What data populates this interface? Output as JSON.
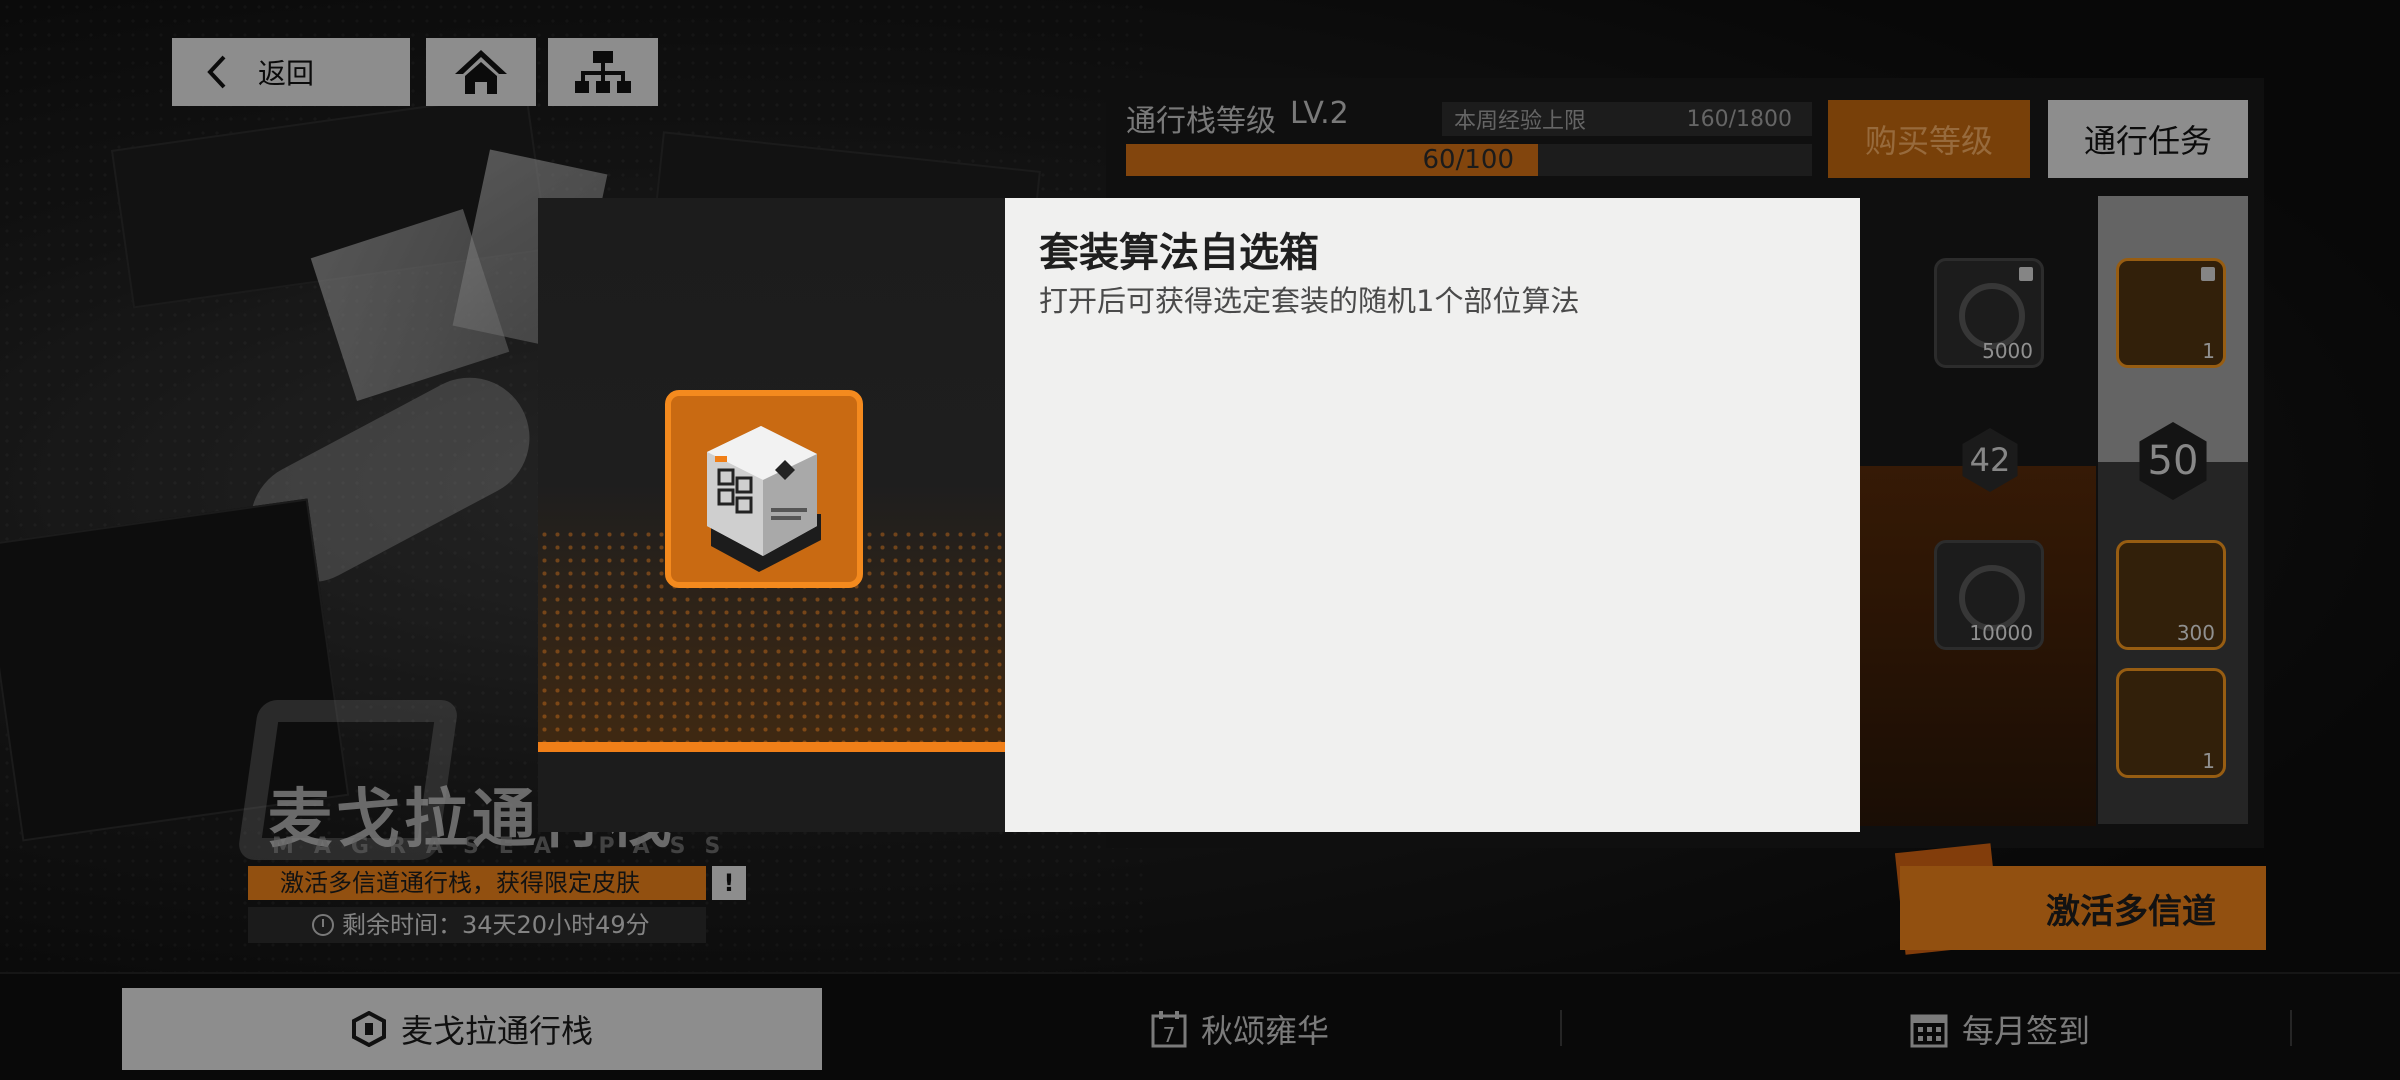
{
  "nav": {
    "back_label": "返回",
    "back_icon": "chevron-left-icon",
    "home_icon": "home-icon",
    "map_icon": "hierarchy-icon"
  },
  "pass": {
    "title": "麦戈拉通行栈",
    "subtitle": "MAGRASEA PASS",
    "promo_text": "激活多信道通行栈，获得限定皮肤",
    "promo_alert": "!",
    "remaining_time": "剩余时间：34天20小时49分",
    "level_label": "通行栈等级",
    "level_value": "LV.2",
    "weekly_cap_label": "本周经验上限",
    "weekly_cap_value": "160/1800",
    "xp_text": "60/100",
    "xp_fraction": 0.6,
    "buy_level_label": "购买等级",
    "tasks_label": "通行任务",
    "activate_label": "激活多信道",
    "rewards": {
      "slot_a_qty": "5000",
      "slot_b_qty": "10000",
      "slot_c_qty": "1",
      "slot_d_qty": "300",
      "slot_e_qty": "1",
      "level_42": "42",
      "level_50": "50"
    }
  },
  "tabs": [
    {
      "label": "麦戈拉通行栈",
      "icon": "pass-logo-icon"
    },
    {
      "label": "秋颂雍华",
      "icon": "calendar-7-icon"
    },
    {
      "label": "每月签到",
      "icon": "calendar-grid-icon"
    }
  ],
  "modal": {
    "item_name": "套装算法自选箱",
    "item_description": "打开后可获得选定套装的随机1个部位算法",
    "item_icon": "algorithm-box-icon"
  },
  "colors": {
    "accent_orange": "#f07f18",
    "panel_light": "#d9d9d9",
    "modal_bg": "#f0f0ef"
  }
}
